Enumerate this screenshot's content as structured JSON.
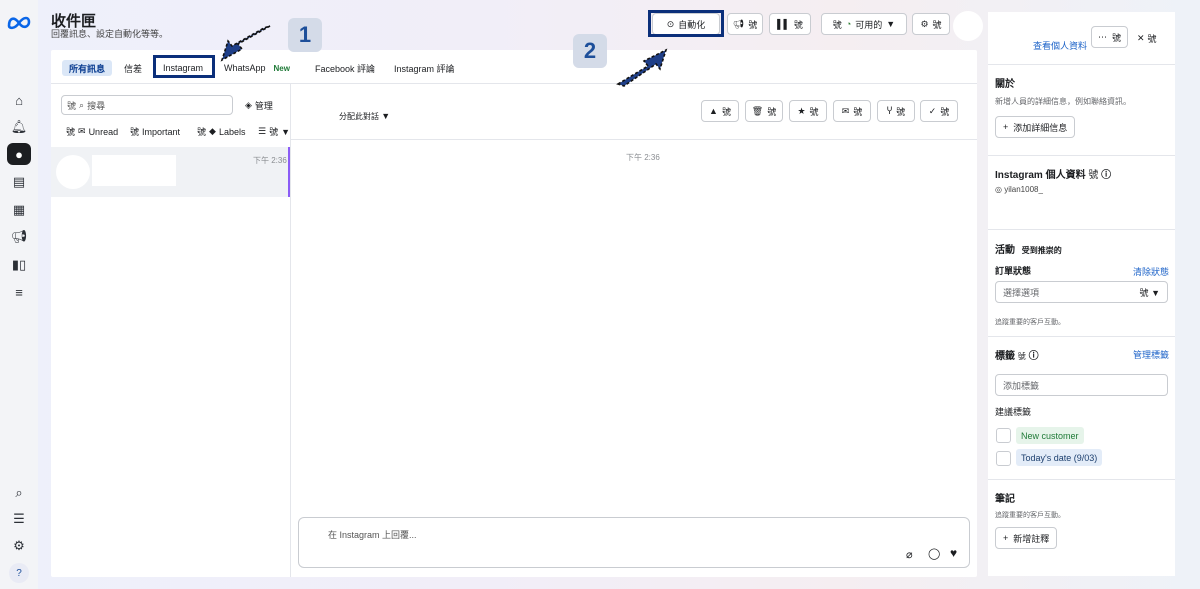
{
  "header": {
    "title": "收件匣",
    "subtitle": "回覆訊息、設定自動化等等。",
    "automation_label": "自動化",
    "btn_promote": "號",
    "btn_insights": "號",
    "availability_prefix": "號",
    "availability_label": "可用的",
    "settings_label": "號"
  },
  "tabs": [
    {
      "label": "所有訊息"
    },
    {
      "label": "信差"
    },
    {
      "label": "Instagram"
    },
    {
      "label": "WhatsApp",
      "badge": "New"
    },
    {
      "label": "Facebook 評論"
    },
    {
      "label": "Instagram 評論"
    }
  ],
  "list": {
    "search_prefix": "號",
    "search_placeholder": "搜尋",
    "manage_label": "管理",
    "filter_unread_prefix": "號",
    "filter_unread": "Unread",
    "filter_important_prefix": "號",
    "filter_important": "Important",
    "filter_labels_prefix": "號",
    "filter_labels": "Labels",
    "filter_more": "號",
    "conversation_time": "下午 2:36"
  },
  "chat": {
    "assign_label": "分配此對話",
    "action_buttons": [
      "號",
      "號",
      "號",
      "號",
      "號",
      "號"
    ],
    "message_time": "下午 2:36",
    "reply_placeholder": "在 Instagram 上回覆..."
  },
  "right": {
    "view_profile": "查看個人資料",
    "more_label": "號",
    "close_label": "號",
    "about_title": "關於",
    "about_desc": "新增人員的詳細信息，例如聯絡資訊。",
    "add_details": "添加詳細信息",
    "ig_profile_title": "Instagram 個人資料",
    "ig_profile_suffix": "號",
    "ig_username": "yilan1008_",
    "activity_title": "活動",
    "activity_sub": "受到推崇的",
    "order_status": "訂單狀態",
    "clear_status": "清除狀態",
    "select_option": "選擇選項",
    "select_suffix": "號",
    "track_text_1": "追蹤重要的客戶互動。",
    "labels_title": "標籤",
    "labels_suffix": "號",
    "manage_labels": "管理標籤",
    "add_label_placeholder": "添加標籤",
    "suggested_labels": "建議標籤",
    "tags": [
      "New customer",
      "Today's date (9/03)"
    ],
    "notes_title": "筆記",
    "track_text_2": "追蹤重要的客戶互動。",
    "add_note": "新增註釋"
  },
  "annotations": {
    "step1": "1",
    "step2": "2"
  },
  "colors": {
    "highlight": "#0b2f7a",
    "step_number": "#1d4f9a",
    "accent_purple": "#8b5cf6",
    "link": "#1d63c8"
  }
}
